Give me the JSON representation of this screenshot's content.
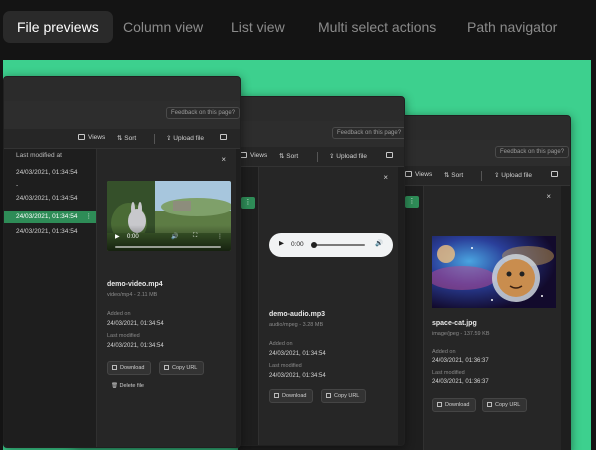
{
  "tabs": [
    {
      "label": "File previews",
      "active": true
    },
    {
      "label": "Column view",
      "active": false
    },
    {
      "label": "List view",
      "active": false
    },
    {
      "label": "Multi select actions",
      "active": false
    },
    {
      "label": "Path navigator",
      "active": false
    }
  ],
  "colors": {
    "stage": "#3dd08e",
    "accent": "#2e8c57",
    "window": "#2d2d2d"
  },
  "common": {
    "feedback": "Feedback on this page?",
    "views": "Views",
    "sort": "Sort",
    "upload": "Upload file",
    "download": "Download",
    "copy_url": "Copy URL",
    "delete": "Delete file",
    "added_on": "Added on",
    "last_modified": "Last modified",
    "close_symbol": "×",
    "more_symbol": "⋮"
  },
  "list": {
    "header": "Last modified at",
    "rows": [
      "24/03/2021, 01:34:54",
      "-",
      "24/03/2021, 01:34:54",
      "24/03/2021, 01:34:54",
      "24/03/2021, 01:34:54"
    ]
  },
  "video": {
    "name": "demo-video.mp4",
    "meta": "video/mp4 - 2.11 MB",
    "time": "0:00",
    "added_on": "24/03/2021, 01:34:54",
    "last_modified": "24/03/2021, 01:34:54"
  },
  "audio": {
    "name": "demo-audio.mp3",
    "meta": "audio/mpeg - 3.28 MB",
    "time": "0:00",
    "added_on": "24/03/2021, 01:34:54",
    "last_modified": "24/03/2021, 01:34:54"
  },
  "image": {
    "name": "space-cat.jpg",
    "meta": "image/jpeg - 137.59 KB",
    "added_on": "24/03/2021, 01:36:37",
    "last_modified": "24/03/2021, 01:36:37"
  }
}
